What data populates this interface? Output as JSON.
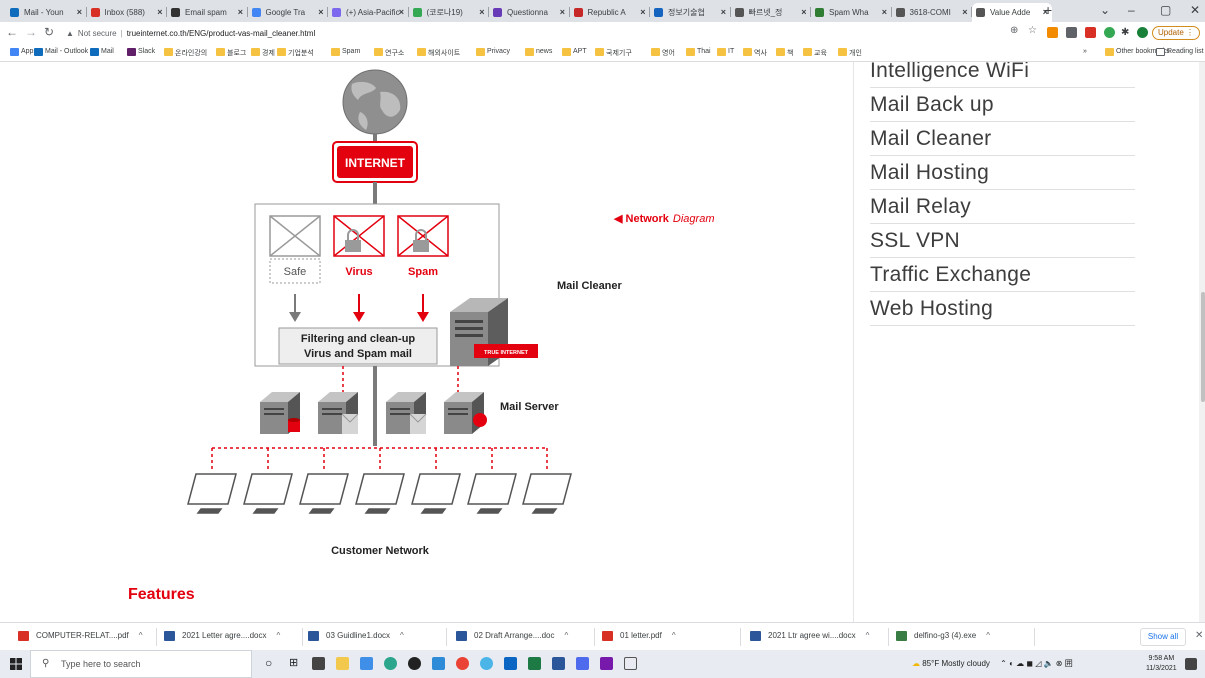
{
  "browser": {
    "tabs": [
      {
        "label": "Mail - Youn",
        "color": "#0f6cbd"
      },
      {
        "label": "Inbox (588)",
        "color": "#d93025"
      },
      {
        "label": "Email spam",
        "color": "#333333"
      },
      {
        "label": "Google Tra",
        "color": "#4285f4"
      },
      {
        "label": "(+) Asia-Pacific",
        "color": "#7b68ee"
      },
      {
        "label": "(코로나19)",
        "color": "#34a853"
      },
      {
        "label": "Questionna",
        "color": "#673ab7"
      },
      {
        "label": "Republic A",
        "color": "#c62828"
      },
      {
        "label": "정보기술협",
        "color": "#1565c0"
      },
      {
        "label": "빠르넷_정",
        "color": "#555555"
      },
      {
        "label": "Spam Wha",
        "color": "#2e7d32"
      },
      {
        "label": "3618-COMI",
        "color": "#555555"
      },
      {
        "label": "Value Adde",
        "color": "#555555",
        "active": true
      }
    ],
    "url_security": "Not secure",
    "url": "trueinternet.co.th/ENG/product-vas-mail_cleaner.html",
    "update_label": "Update",
    "bookmarks": [
      {
        "label": "Apps",
        "kind": "apps"
      },
      {
        "label": "Mail - Outlook",
        "kind": "outlook"
      },
      {
        "label": "Mail",
        "kind": "outlook"
      },
      {
        "label": "Slack",
        "kind": "slack"
      },
      {
        "label": "온라인강의",
        "kind": "folder"
      },
      {
        "label": "블로그",
        "kind": "folder"
      },
      {
        "label": "경제",
        "kind": "folder"
      },
      {
        "label": "기업분석",
        "kind": "folder"
      },
      {
        "label": "Spam",
        "kind": "folder"
      },
      {
        "label": "연구소",
        "kind": "folder"
      },
      {
        "label": "해외사이트",
        "kind": "folder"
      },
      {
        "label": "Privacy",
        "kind": "folder"
      },
      {
        "label": "news",
        "kind": "folder"
      },
      {
        "label": "APT",
        "kind": "folder"
      },
      {
        "label": "국제기구",
        "kind": "folder"
      },
      {
        "label": "영어",
        "kind": "folder"
      },
      {
        "label": "Thai",
        "kind": "folder"
      },
      {
        "label": "IT",
        "kind": "folder"
      },
      {
        "label": "역사",
        "kind": "folder"
      },
      {
        "label": "책",
        "kind": "folder"
      },
      {
        "label": "교육",
        "kind": "folder"
      },
      {
        "label": "개인",
        "kind": "folder"
      }
    ],
    "overflow": "»",
    "other_bookmarks": "Other bookmarks",
    "reading_list": "Reading list"
  },
  "sidenav": {
    "items": [
      "Intelligence WiFi",
      "Mail Back up",
      "Mail Cleaner",
      "Mail Hosting",
      "Mail Relay",
      "SSL VPN",
      "Traffic Exchange",
      "Web Hosting"
    ]
  },
  "diagram": {
    "internet": "INTERNET",
    "caption_prefix": "◀ Network",
    "caption_suffix": "Diagram",
    "safe": "Safe",
    "virus": "Virus",
    "spam": "Spam",
    "mail_cleaner": "Mail Cleaner",
    "filter_line1": "Filtering and clean-up",
    "filter_line2": "Virus and Spam mail",
    "brand_tag": "TRUE INTERNET",
    "mail_server": "Mail Server",
    "customer_network": "Customer Network"
  },
  "features_heading": "Features",
  "downloads": {
    "items": [
      {
        "label": "COMPUTER-RELAT....pdf",
        "kind": "pdf"
      },
      {
        "label": "2021 Letter agre....docx",
        "kind": "docx"
      },
      {
        "label": "03 Guidline1.docx",
        "kind": "docx"
      },
      {
        "label": "02 Draft Arrange....doc",
        "kind": "docx"
      },
      {
        "label": "01 letter.pdf",
        "kind": "pdf"
      },
      {
        "label": "2021 Ltr agree wi....docx",
        "kind": "docx"
      },
      {
        "label": "delfino-g3 (4).exe",
        "kind": "exe"
      }
    ],
    "show_all": "Show all"
  },
  "taskbar": {
    "search_placeholder": "Type here to search",
    "weather": "85°F  Mostly cloudy",
    "time": "9:58 AM",
    "date": "11/3/2021",
    "colors": {
      "pdf": "#d93025",
      "docx": "#2b579a",
      "exe": "#3a7d44",
      "accent_red": "#e3000f"
    }
  }
}
